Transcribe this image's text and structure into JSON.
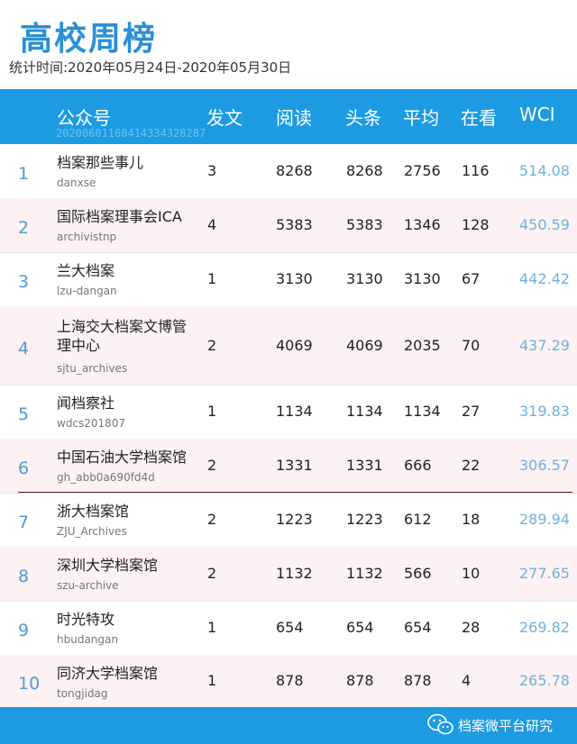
{
  "title": "高校周榜",
  "period": "统计时间:2020年05月24日-2020年05月30日",
  "table": {
    "headers": {
      "account": "公众号",
      "posts": "发文",
      "reads": "阅读",
      "headline": "头条",
      "average": "平均",
      "likes": "在看",
      "wci": "WCI"
    },
    "stamp": "20200601160414334328287",
    "rows": [
      {
        "rank": "1",
        "name": "档案那些事儿",
        "account": "danxse",
        "posts": "3",
        "reads": "8268",
        "headline": "8268",
        "average": "2756",
        "likes": "116",
        "wci": "514.08"
      },
      {
        "rank": "2",
        "name": "国际档案理事会ICA",
        "account": "archivistnp",
        "posts": "4",
        "reads": "5383",
        "headline": "5383",
        "average": "1346",
        "likes": "128",
        "wci": "450.59"
      },
      {
        "rank": "3",
        "name": "兰大档案",
        "account": "lzu-dangan",
        "posts": "1",
        "reads": "3130",
        "headline": "3130",
        "average": "3130",
        "likes": "67",
        "wci": "442.42"
      },
      {
        "rank": "4",
        "name": "上海交大档案文博管理中心",
        "account": "sjtu_archives",
        "posts": "2",
        "reads": "4069",
        "headline": "4069",
        "average": "2035",
        "likes": "70",
        "wci": "437.29"
      },
      {
        "rank": "5",
        "name": "闻档察社",
        "account": "wdcs201807",
        "posts": "1",
        "reads": "1134",
        "headline": "1134",
        "average": "1134",
        "likes": "27",
        "wci": "319.83"
      },
      {
        "rank": "6",
        "name": "中国石油大学档案馆",
        "account": "gh_abb0a690fd4d",
        "posts": "2",
        "reads": "1331",
        "headline": "1331",
        "average": "666",
        "likes": "22",
        "wci": "306.57"
      },
      {
        "rank": "7",
        "name": "浙大档案馆",
        "account": "ZJU_Archives",
        "posts": "2",
        "reads": "1223",
        "headline": "1223",
        "average": "612",
        "likes": "18",
        "wci": "289.94"
      },
      {
        "rank": "8",
        "name": "深圳大学档案馆",
        "account": "szu-archive",
        "posts": "2",
        "reads": "1132",
        "headline": "1132",
        "average": "566",
        "likes": "10",
        "wci": "277.65"
      },
      {
        "rank": "9",
        "name": "时光特攻",
        "account": "hbudangan",
        "posts": "1",
        "reads": "654",
        "headline": "654",
        "average": "654",
        "likes": "28",
        "wci": "269.82"
      },
      {
        "rank": "10",
        "name": "同济大学档案馆",
        "account": "tongjidag",
        "posts": "1",
        "reads": "878",
        "headline": "878",
        "average": "878",
        "likes": "4",
        "wci": "265.78"
      }
    ]
  },
  "footer": {
    "text": "档案微平台研究",
    "icon": "wechat-icon"
  },
  "colors": {
    "header": "#1c9be3",
    "title": "#2a8fd6",
    "alt_row": "#fdf1f3",
    "wci": "#6fb1dc"
  }
}
